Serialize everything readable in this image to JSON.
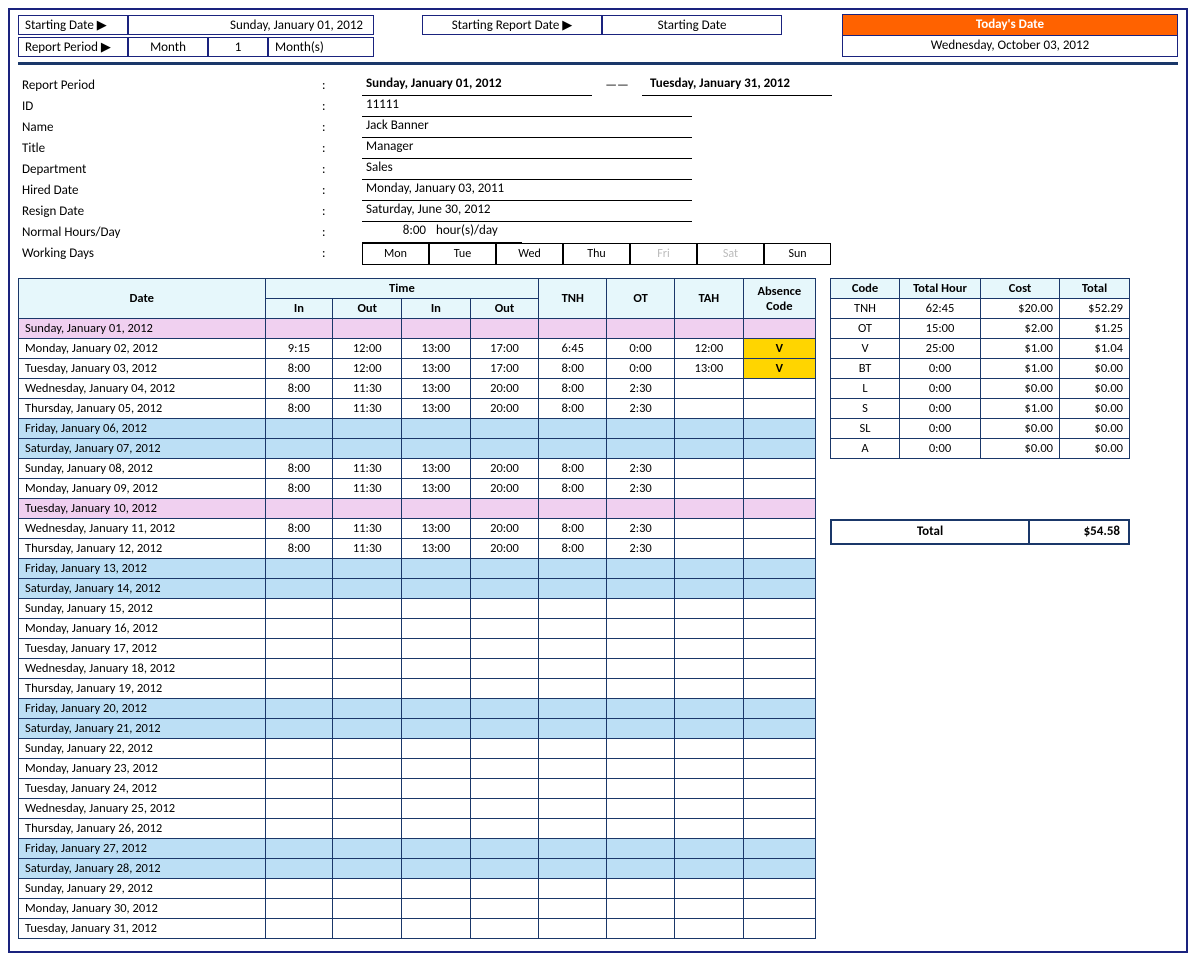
{
  "top": {
    "starting_date_label": "Starting Date ▶",
    "starting_date_value": "Sunday, January 01, 2012",
    "report_period_label": "Report Period ▶",
    "report_period_unit": "Month",
    "report_period_qty": "1",
    "report_period_suffix": "Month(s)",
    "starting_report_date_label": "Starting Report Date ▶",
    "starting_report_date_value": "Starting Date",
    "todays_date_label": "Today's Date",
    "todays_date_value": "Wednesday, October 03, 2012"
  },
  "info": {
    "report_period_label": "Report Period",
    "report_period_from": "Sunday, January 01, 2012",
    "report_period_dash": "——",
    "report_period_to": "Tuesday, January 31, 2012",
    "id_label": "ID",
    "id_value": "11111",
    "name_label": "Name",
    "name_value": "Jack Banner",
    "title_label": "Title",
    "title_value": "Manager",
    "dept_label": "Department",
    "dept_value": "Sales",
    "hired_label": "Hired Date",
    "hired_value": "Monday, January 03, 2011",
    "resign_label": "Resign Date",
    "resign_value": "Saturday, June 30, 2012",
    "normal_hours_label": "Normal Hours/Day",
    "normal_hours_value": "8:00",
    "normal_hours_suffix": "hour(s)/day",
    "working_days_label": "Working Days",
    "days": [
      "Mon",
      "Tue",
      "Wed",
      "Thu",
      "Fri",
      "Sat",
      "Sun"
    ],
    "days_off": [
      false,
      false,
      false,
      false,
      true,
      true,
      false
    ]
  },
  "grid": {
    "headers": {
      "date": "Date",
      "time": "Time",
      "in": "In",
      "out": "Out",
      "tnh": "TNH",
      "ot": "OT",
      "tah": "TAH",
      "abs": "Absence Code"
    },
    "rows": [
      {
        "type": "pink",
        "date": "Sunday, January 01, 2012"
      },
      {
        "type": "ylw",
        "date": "Monday, January 02, 2012",
        "in1": "9:15",
        "out1": "12:00",
        "in2": "13:00",
        "out2": "17:00",
        "tnh": "6:45",
        "ot": "0:00",
        "tah": "12:00",
        "abs": "V"
      },
      {
        "type": "ylw",
        "date": "Tuesday, January 03, 2012",
        "in1": "8:00",
        "out1": "12:00",
        "in2": "13:00",
        "out2": "17:00",
        "tnh": "8:00",
        "ot": "0:00",
        "tah": "13:00",
        "abs": "V"
      },
      {
        "type": "",
        "date": "Wednesday, January 04, 2012",
        "in1": "8:00",
        "out1": "11:30",
        "in2": "13:00",
        "out2": "20:00",
        "tnh": "8:00",
        "ot": "2:30",
        "tah": "",
        "abs": ""
      },
      {
        "type": "",
        "date": "Thursday, January 05, 2012",
        "in1": "8:00",
        "out1": "11:30",
        "in2": "13:00",
        "out2": "20:00",
        "tnh": "8:00",
        "ot": "2:30",
        "tah": "",
        "abs": ""
      },
      {
        "type": "blue",
        "date": "Friday, January 06, 2012"
      },
      {
        "type": "blue",
        "date": "Saturday, January 07, 2012"
      },
      {
        "type": "",
        "date": "Sunday, January 08, 2012",
        "in1": "8:00",
        "out1": "11:30",
        "in2": "13:00",
        "out2": "20:00",
        "tnh": "8:00",
        "ot": "2:30",
        "tah": "",
        "abs": ""
      },
      {
        "type": "",
        "date": "Monday, January 09, 2012",
        "in1": "8:00",
        "out1": "11:30",
        "in2": "13:00",
        "out2": "20:00",
        "tnh": "8:00",
        "ot": "2:30",
        "tah": "",
        "abs": ""
      },
      {
        "type": "pink",
        "date": "Tuesday, January 10, 2012"
      },
      {
        "type": "",
        "date": "Wednesday, January 11, 2012",
        "in1": "8:00",
        "out1": "11:30",
        "in2": "13:00",
        "out2": "20:00",
        "tnh": "8:00",
        "ot": "2:30",
        "tah": "",
        "abs": ""
      },
      {
        "type": "",
        "date": "Thursday, January 12, 2012",
        "in1": "8:00",
        "out1": "11:30",
        "in2": "13:00",
        "out2": "20:00",
        "tnh": "8:00",
        "ot": "2:30",
        "tah": "",
        "abs": ""
      },
      {
        "type": "blue",
        "date": "Friday, January 13, 2012"
      },
      {
        "type": "blue",
        "date": "Saturday, January 14, 2012"
      },
      {
        "type": "",
        "date": "Sunday, January 15, 2012"
      },
      {
        "type": "",
        "date": "Monday, January 16, 2012"
      },
      {
        "type": "",
        "date": "Tuesday, January 17, 2012"
      },
      {
        "type": "",
        "date": "Wednesday, January 18, 2012"
      },
      {
        "type": "",
        "date": "Thursday, January 19, 2012"
      },
      {
        "type": "blue",
        "date": "Friday, January 20, 2012"
      },
      {
        "type": "blue",
        "date": "Saturday, January 21, 2012"
      },
      {
        "type": "",
        "date": "Sunday, January 22, 2012"
      },
      {
        "type": "",
        "date": "Monday, January 23, 2012"
      },
      {
        "type": "",
        "date": "Tuesday, January 24, 2012"
      },
      {
        "type": "",
        "date": "Wednesday, January 25, 2012"
      },
      {
        "type": "",
        "date": "Thursday, January 26, 2012"
      },
      {
        "type": "blue",
        "date": "Friday, January 27, 2012"
      },
      {
        "type": "blue",
        "date": "Saturday, January 28, 2012"
      },
      {
        "type": "",
        "date": "Sunday, January 29, 2012"
      },
      {
        "type": "",
        "date": "Monday, January 30, 2012"
      },
      {
        "type": "",
        "date": "Tuesday, January 31, 2012"
      }
    ]
  },
  "summary": {
    "headers": {
      "code": "Code",
      "hour": "Total Hour",
      "cost": "Cost",
      "total": "Total"
    },
    "rows": [
      {
        "code": "TNH",
        "hour": "62:45",
        "cost": "$20.00",
        "total": "$52.29"
      },
      {
        "code": "OT",
        "hour": "15:00",
        "cost": "$2.00",
        "total": "$1.25"
      },
      {
        "code": "V",
        "hour": "25:00",
        "cost": "$1.00",
        "total": "$1.04"
      },
      {
        "code": "BT",
        "hour": "0:00",
        "cost": "$1.00",
        "total": "$0.00"
      },
      {
        "code": "L",
        "hour": "0:00",
        "cost": "$0.00",
        "total": "$0.00"
      },
      {
        "code": "S",
        "hour": "0:00",
        "cost": "$1.00",
        "total": "$0.00"
      },
      {
        "code": "SL",
        "hour": "0:00",
        "cost": "$0.00",
        "total": "$0.00"
      },
      {
        "code": "A",
        "hour": "0:00",
        "cost": "$0.00",
        "total": "$0.00"
      }
    ],
    "grand_label": "Total",
    "grand_total": "$54.58"
  }
}
